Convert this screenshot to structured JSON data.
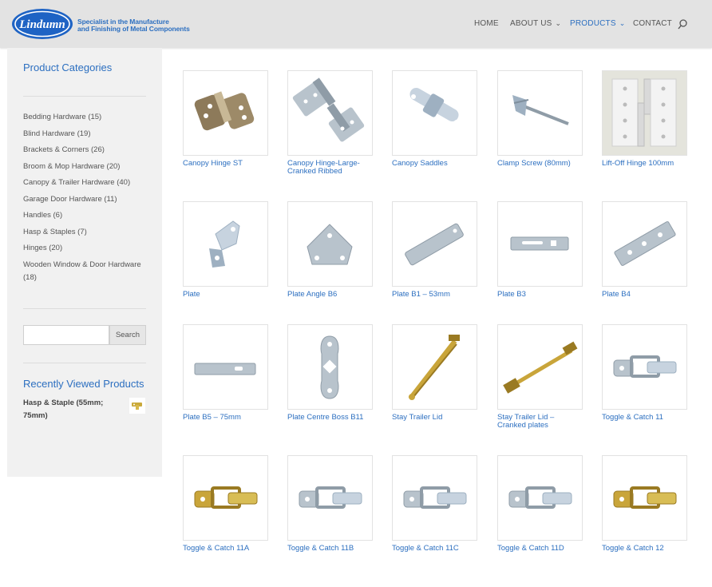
{
  "brand": {
    "logo_text": "Lindumn",
    "tagline_line1": "Specialist in the Manufacture",
    "tagline_line2": "and Finishing of Metal Components"
  },
  "nav": {
    "home": "HOME",
    "about": "ABOUT US",
    "products": "PRODUCTS",
    "contact": "CONTACT"
  },
  "sidebar": {
    "categories_title": "Product Categories",
    "categories": [
      "Bedding Hardware (15)",
      "Blind Hardware (19)",
      "Brackets & Corners (26)",
      "Broom & Mop Hardware (20)",
      "Canopy & Trailer Hardware (40)",
      "Garage Door Hardware (11)",
      "Handles (6)",
      "Hasp & Staples (7)",
      "Hinges (20)",
      "Wooden Window & Door Hardware (18)"
    ],
    "search_placeholder": "",
    "search_button": "Search",
    "recent_title": "Recently Viewed Products",
    "recent_item": "Hasp & Staple (55mm; 75mm)"
  },
  "products": [
    {
      "name": "Canopy Hinge ST",
      "icon": "hinge-icon"
    },
    {
      "name": "Canopy Hinge-Large-Cranked Ribbed",
      "icon": "cranked-hinge-icon"
    },
    {
      "name": "Canopy Saddles",
      "icon": "saddle-icon"
    },
    {
      "name": "Clamp Screw (80mm)",
      "icon": "clamp-screw-icon"
    },
    {
      "name": "Lift-Off Hinge 100mm",
      "icon": "lift-off-hinge-icon"
    },
    {
      "name": "Plate",
      "icon": "angle-plate-icon"
    },
    {
      "name": "Plate Angle B6",
      "icon": "triangle-plate-icon"
    },
    {
      "name": "Plate B1 – 53mm",
      "icon": "strip-plate-icon"
    },
    {
      "name": "Plate B3",
      "icon": "slotted-plate-icon"
    },
    {
      "name": "Plate B4",
      "icon": "holed-plate-icon"
    },
    {
      "name": "Plate B5 – 75mm",
      "icon": "long-plate-icon"
    },
    {
      "name": "Plate Centre Boss B11",
      "icon": "boss-plate-icon"
    },
    {
      "name": "Stay Trailer Lid",
      "icon": "stay-icon"
    },
    {
      "name": "Stay Trailer Lid – Cranked plates",
      "icon": "cranked-stay-icon"
    },
    {
      "name": "Toggle & Catch 11",
      "icon": "toggle-catch-icon"
    },
    {
      "name": "Toggle & Catch 11A",
      "icon": "toggle-catch-icon"
    },
    {
      "name": "Toggle & Catch 11B",
      "icon": "toggle-catch-icon"
    },
    {
      "name": "Toggle & Catch 11C",
      "icon": "toggle-catch-icon"
    },
    {
      "name": "Toggle & Catch 11D",
      "icon": "toggle-catch-icon"
    },
    {
      "name": "Toggle & Catch 12",
      "icon": "toggle-catch-icon"
    }
  ],
  "colors": {
    "accent": "#2c6fc0",
    "header_bg": "#e3e3e3",
    "sidebar_bg": "#f1f1f1"
  }
}
